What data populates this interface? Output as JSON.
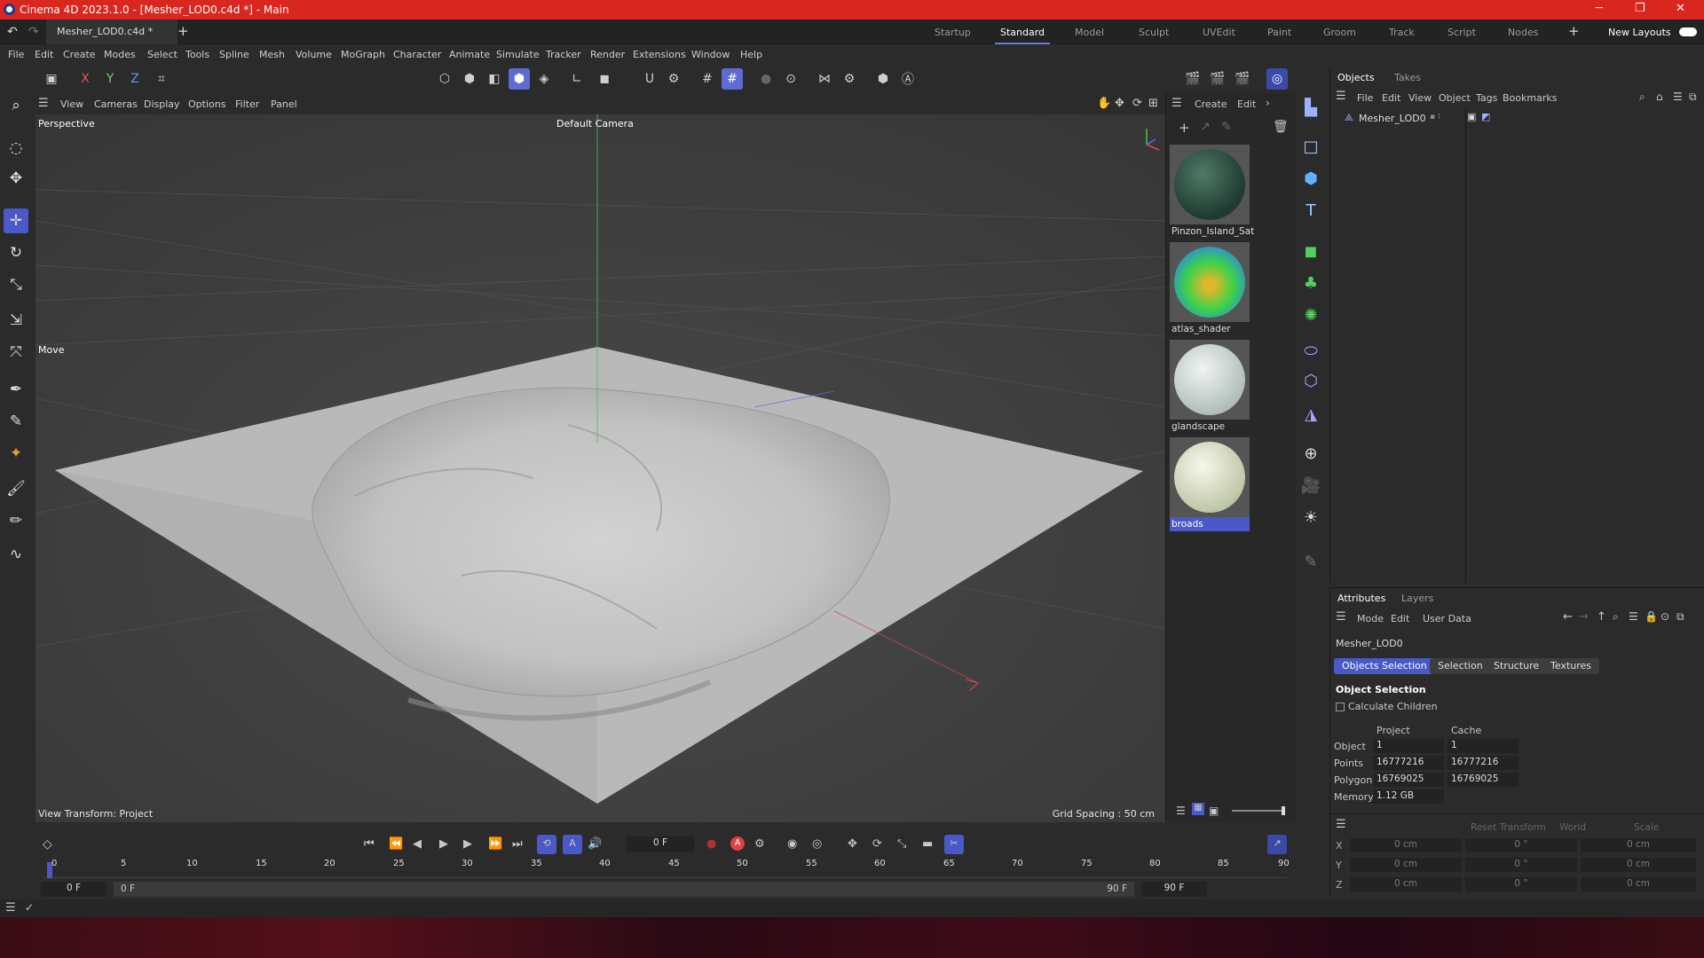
{
  "titlebar": {
    "title": "Cinema 4D 2023.1.0 - [Mesher_LOD0.c4d *] - Main"
  },
  "doc_tab": {
    "label": "Mesher_LOD0.c4d *"
  },
  "layouts": [
    {
      "label": "Startup"
    },
    {
      "label": "Standard",
      "active": true
    },
    {
      "label": "Model"
    },
    {
      "label": "Sculpt"
    },
    {
      "label": "UVEdit"
    },
    {
      "label": "Paint"
    },
    {
      "label": "Groom"
    },
    {
      "label": "Track"
    },
    {
      "label": "Script"
    },
    {
      "label": "Nodes"
    }
  ],
  "new_layouts": "New Layouts",
  "menu": [
    "File",
    "Edit",
    "Create",
    "Modes",
    "Select",
    "Tools",
    "Spline",
    "Mesh",
    "Volume",
    "MoGraph",
    "Character",
    "Animate",
    "Simulate",
    "Tracker",
    "Render",
    "Extensions",
    "Window",
    "Help"
  ],
  "axis_buttons": [
    "X",
    "Y",
    "Z"
  ],
  "viewport": {
    "menu": [
      "View",
      "Cameras",
      "Display",
      "Options",
      "Filter",
      "Panel"
    ],
    "label": "Perspective",
    "camera": "Default Camera",
    "tool": "Move",
    "view_transform": "View Transform: Project",
    "grid_spacing": "Grid Spacing : 50 cm"
  },
  "materials": {
    "menu": [
      "Create",
      "Edit"
    ],
    "items": [
      {
        "name": "Pinzon_Island_Sat",
        "color": "#2f5a48"
      },
      {
        "name": "atlas_shader",
        "color": "#3cd24a"
      },
      {
        "name": "glandscape",
        "color": "#d8e2de"
      },
      {
        "name": "broads",
        "color": "#e3e8d0",
        "selected": true
      }
    ]
  },
  "objects": {
    "tabs": [
      "Objects",
      "Takes"
    ],
    "menu": [
      "File",
      "Edit",
      "View",
      "Object",
      "Tags",
      "Bookmarks"
    ],
    "items": [
      {
        "name": "Mesher_LOD0"
      }
    ]
  },
  "attributes": {
    "tabs": [
      "Attributes",
      "Layers"
    ],
    "menu": [
      "Mode",
      "Edit",
      "User Data"
    ],
    "object_name": "Mesher_LOD0",
    "subtabs": [
      "Objects Selection",
      "Selection",
      "Structure",
      "Textures"
    ],
    "section": "Object Selection",
    "calc_children": "Calculate Children",
    "col_project": "Project",
    "col_cache": "Cache",
    "rows": [
      {
        "label": "Object",
        "project": "1",
        "cache": "1"
      },
      {
        "label": "Points",
        "project": "16777216",
        "cache": "16777216"
      },
      {
        "label": "Polygons",
        "project": "16769025",
        "cache": "16769025"
      },
      {
        "label": "Memory",
        "project": "1.12 GB",
        "cache": ""
      }
    ]
  },
  "coords": {
    "reset": "Reset Transform",
    "space": "World",
    "mode": "Scale",
    "rows": [
      {
        "axis": "X",
        "pos": "0 cm",
        "rot": "0 °",
        "scale": "0 cm"
      },
      {
        "axis": "Y",
        "pos": "0 cm",
        "rot": "0 °",
        "scale": "0 cm"
      },
      {
        "axis": "Z",
        "pos": "0 cm",
        "rot": "0 °",
        "scale": "0 cm"
      }
    ]
  },
  "timeline": {
    "current_frame": "0 F",
    "ticks": [
      "0",
      "5",
      "10",
      "15",
      "20",
      "25",
      "30",
      "35",
      "40",
      "45",
      "50",
      "55",
      "60",
      "65",
      "70",
      "75",
      "80",
      "85",
      "90"
    ],
    "start": "0 F",
    "range_start": "0 F",
    "range_end": "90 F",
    "end": "90 F"
  }
}
